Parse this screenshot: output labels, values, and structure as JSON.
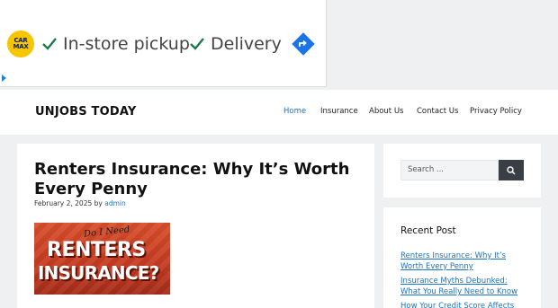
{
  "ad": {
    "brand": "CAR MAX",
    "items": [
      "In-store pickup",
      "Delivery"
    ],
    "info_icon": "info-triangle-icon"
  },
  "header": {
    "site_title": "UNJOBS TODAY",
    "nav": [
      "Home",
      "Insurance",
      "About Us",
      "Contact Us",
      "Privacy Policy"
    ],
    "active_nav": "Home"
  },
  "post": {
    "title": "Renters Insurance: Why It’s Worth Every Penny",
    "date": "February 2, 2025",
    "by": "by",
    "author": "admin",
    "thumbnail": {
      "handwritten": "Do I Need",
      "line1": "RENTERS",
      "line2": "INSURANCE?"
    }
  },
  "sidebar": {
    "search_placeholder": "Search ...",
    "recent_title": "Recent Post",
    "recent_posts": [
      "Renters Insurance: Why It’s Worth Every Penny",
      "Insurance Myths Debunked: What You Really Need to Know",
      "How Your Credit Score Affects"
    ]
  },
  "colors": {
    "accent": "#1e72bd",
    "background": "#eef0f2",
    "search_button": "#3a3f45",
    "ad_check": "#1a7a4a",
    "ad_arrow": "#1a73e8"
  }
}
